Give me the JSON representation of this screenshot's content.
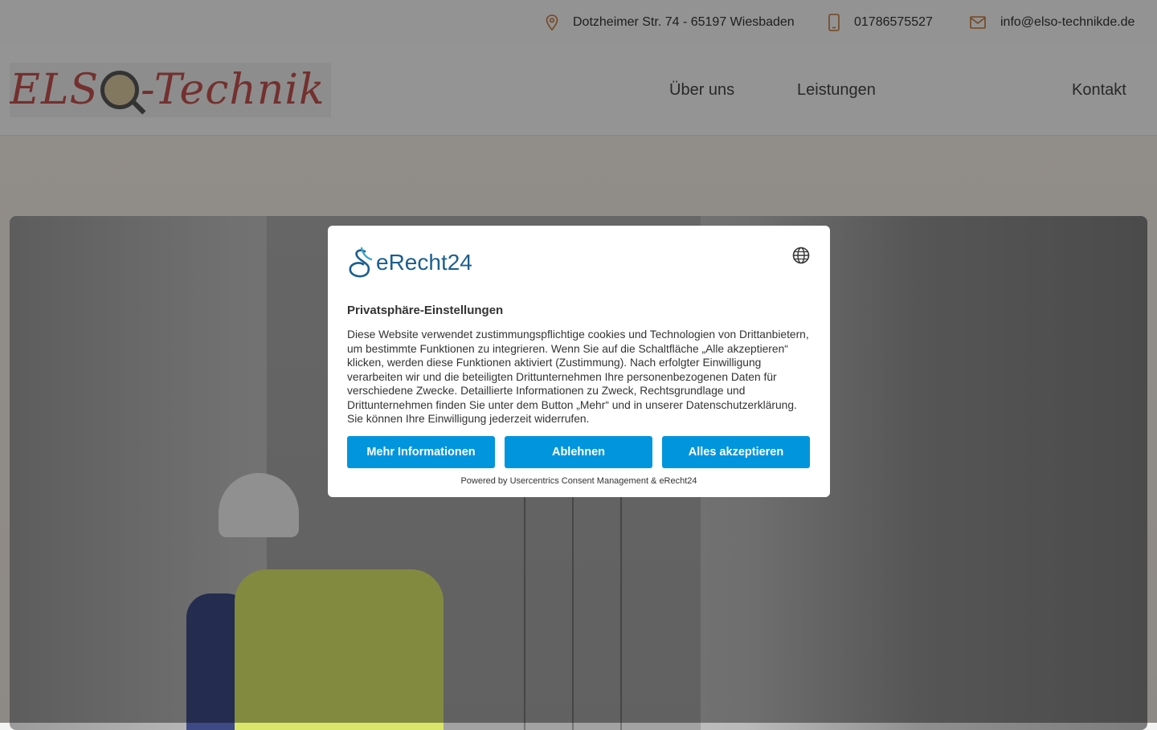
{
  "topbar": {
    "address": "Dotzheimer Str. 74 - 65197 Wiesbaden",
    "phone": "01786575527",
    "email": "info@elso-technikde.de",
    "icon_color": "#c1753a"
  },
  "logo": {
    "text_left": "ELS",
    "text_right": "-Technik",
    "color": "#c0504d"
  },
  "nav": [
    {
      "label": "Über uns"
    },
    {
      "label": "Leistungen"
    },
    {
      "label": "Kontakt"
    }
  ],
  "dialog": {
    "brand": "eRecht24",
    "title": "Privatsphäre-Einstellungen",
    "text": "Diese Website verwendet zustimmungspflichtige cookies und Technologien von Drittanbietern, um bestimmte Funktionen zu integrieren. Wenn Sie auf die Schaltfläche „Alle akzeptieren“ klicken, werden diese Funktionen aktiviert (Zustimmung). Nach erfolgter Einwilligung verarbeiten wir und die beteiligten Drittunternehmen Ihre personenbezogenen Daten für verschiedene Zwecke. Detaillierte Informationen zu Zweck, Rechtsgrundlage und Drittunternehmen finden Sie unter dem Button „Mehr“ und in unserer Datenschutzerklärung. Sie können Ihre Einwilligung jederzeit widerrufen.",
    "buttons": {
      "more": "Mehr Informationen",
      "deny": "Ablehnen",
      "accept": "Alles akzeptieren"
    },
    "powered": "Powered by Usercentrics Consent Management & eRecht24",
    "accent": "#0095dd"
  }
}
